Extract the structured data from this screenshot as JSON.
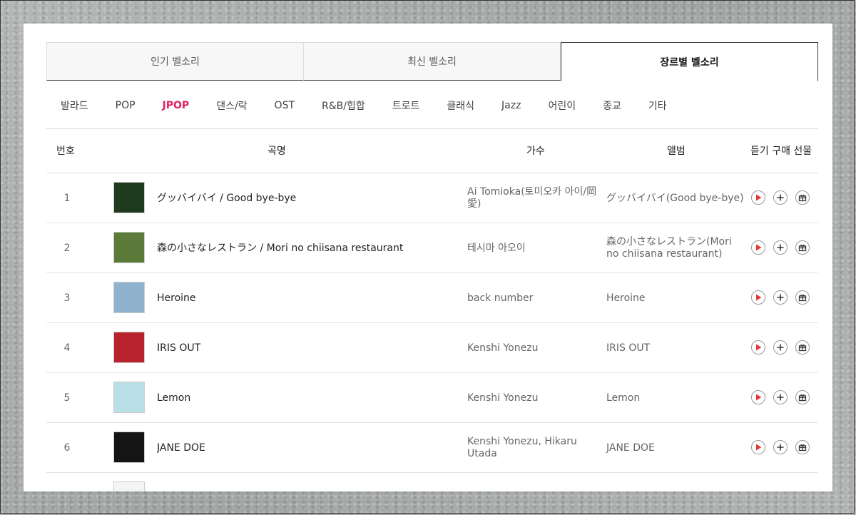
{
  "tabs": [
    {
      "label": "인기 벨소리"
    },
    {
      "label": "최신 벨소리"
    },
    {
      "label": "장르별 벨소리"
    }
  ],
  "genres": [
    {
      "label": "발라드"
    },
    {
      "label": "POP"
    },
    {
      "label": "JPOP"
    },
    {
      "label": "댄스/락"
    },
    {
      "label": "OST"
    },
    {
      "label": "R&B/힙합"
    },
    {
      "label": "트로트"
    },
    {
      "label": "클래식"
    },
    {
      "label": "Jazz"
    },
    {
      "label": "어린이"
    },
    {
      "label": "종교"
    },
    {
      "label": "기타"
    }
  ],
  "table": {
    "headers": {
      "number": "번호",
      "title": "곡명",
      "artist": "가수",
      "album": "앨범",
      "actions": "듣기 구매 선물"
    },
    "rows": [
      {
        "number": "1",
        "title": "グッバイバイ / Good bye-bye",
        "artist": "Ai Tomioka(토미오카 아이/岡 愛)",
        "album": "グッバイバイ(Good bye-bye)",
        "cover_color": "#1f3b1f"
      },
      {
        "number": "2",
        "title": "森の小さなレストラン / Mori no chiisana restaurant",
        "artist": "테시마 아오이",
        "album": "森の小さなレストラン(Mori no chiisana restaurant)",
        "cover_color": "#5c7a3a"
      },
      {
        "number": "3",
        "title": "Heroine",
        "artist": "back number",
        "album": "Heroine",
        "cover_color": "#8fb3cc"
      },
      {
        "number": "4",
        "title": "IRIS OUT",
        "artist": "Kenshi Yonezu",
        "album": "IRIS OUT",
        "cover_color": "#b8232e"
      },
      {
        "number": "5",
        "title": "Lemon",
        "artist": "Kenshi Yonezu",
        "album": "Lemon",
        "cover_color": "#b9dfe6"
      },
      {
        "number": "6",
        "title": "JANE DOE",
        "artist": "Kenshi Yonezu, Hikaru Utada",
        "album": "JANE DOE",
        "cover_color": "#141414"
      }
    ]
  },
  "icons": {
    "play": "play-icon",
    "add": "plus-icon",
    "gift": "gift-icon"
  },
  "colors": {
    "accent": "#e0245e",
    "play": "#e53935"
  }
}
